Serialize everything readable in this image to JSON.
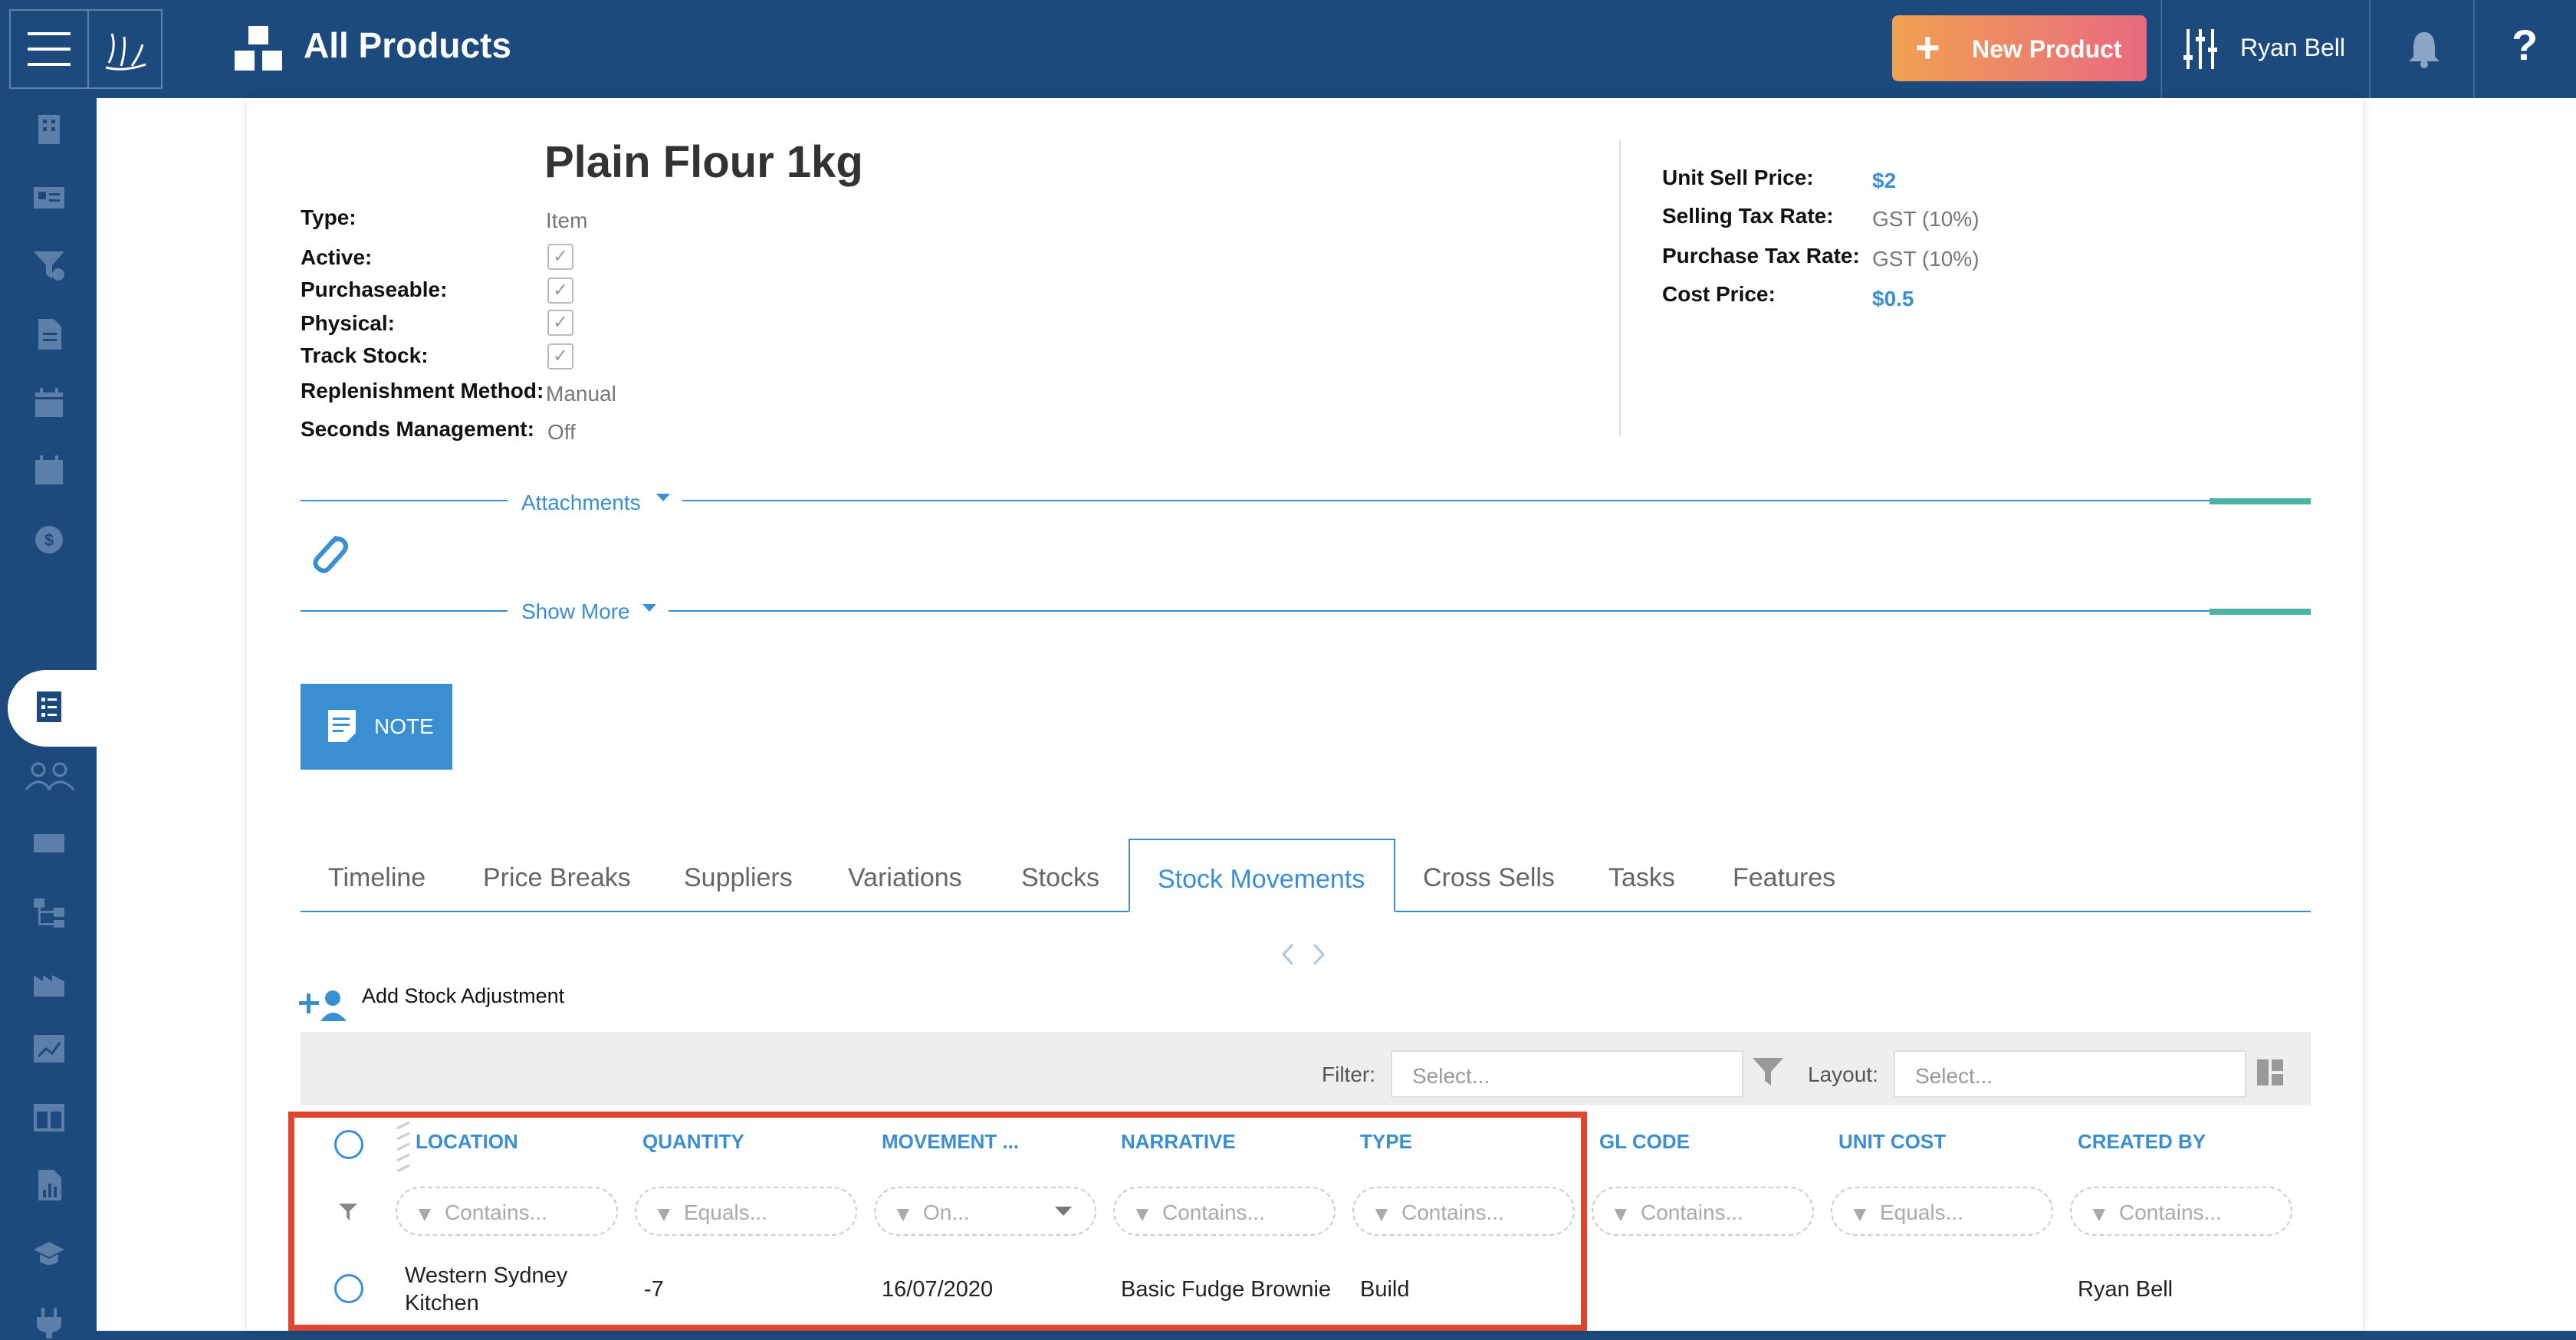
{
  "header": {
    "title": "All Products",
    "new_button": "New Product",
    "user_name": "Ryan Bell",
    "help": "?"
  },
  "product": {
    "name": "Plain Flour 1kg",
    "fields": {
      "type_label": "Type:",
      "type_value": "Item",
      "active_label": "Active:",
      "purchaseable_label": "Purchaseable:",
      "physical_label": "Physical:",
      "track_stock_label": "Track Stock:",
      "replenishment_label": "Replenishment Method:",
      "replenishment_value": "Manual",
      "seconds_label": "Seconds Management:",
      "seconds_value": "Off"
    },
    "pricing": {
      "unit_sell_label": "Unit Sell Price:",
      "unit_sell_value": "$2",
      "selling_tax_label": "Selling Tax Rate:",
      "selling_tax_value": "GST (10%)",
      "purchase_tax_label": "Purchase Tax Rate:",
      "purchase_tax_value": "GST (10%)",
      "cost_label": "Cost Price:",
      "cost_value": "$0.5"
    }
  },
  "sections": {
    "attachments": "Attachments",
    "show_more": "Show More",
    "note": "NOTE"
  },
  "tabs": [
    {
      "label": "Timeline"
    },
    {
      "label": "Price Breaks"
    },
    {
      "label": "Suppliers"
    },
    {
      "label": "Variations"
    },
    {
      "label": "Stocks"
    },
    {
      "label": "Stock Movements"
    },
    {
      "label": "Cross Sells"
    },
    {
      "label": "Tasks"
    },
    {
      "label": "Features"
    }
  ],
  "active_tab": "Stock Movements",
  "toolbar": {
    "add_adjustment": "Add Stock Adjustment",
    "filter_label": "Filter:",
    "filter_placeholder": "Select...",
    "layout_label": "Layout:",
    "layout_placeholder": "Select..."
  },
  "table": {
    "columns": [
      {
        "header": "LOCATION",
        "filter": "Contains..."
      },
      {
        "header": "QUANTITY",
        "filter": "Equals..."
      },
      {
        "header": "MOVEMENT ...",
        "filter": "On..."
      },
      {
        "header": "NARRATIVE",
        "filter": "Contains..."
      },
      {
        "header": "TYPE",
        "filter": "Contains..."
      },
      {
        "header": "GL CODE",
        "filter": "Contains..."
      },
      {
        "header": "UNIT COST",
        "filter": "Equals..."
      },
      {
        "header": "CREATED BY",
        "filter": "Contains..."
      }
    ],
    "rows": [
      {
        "location_line1": "Western Sydney",
        "location_line2": "Kitchen",
        "quantity": "-7",
        "movement": "16/07/2020",
        "narrative": "Basic Fudge Brownie",
        "type": "Build",
        "gl_code": "",
        "unit_cost": "",
        "created_by": "Ryan Bell"
      }
    ]
  },
  "colors": {
    "nav": "#1c4a7c",
    "accent": "#3a8fd2",
    "teal": "#4bb3a5",
    "highlight": "#e0452f"
  }
}
